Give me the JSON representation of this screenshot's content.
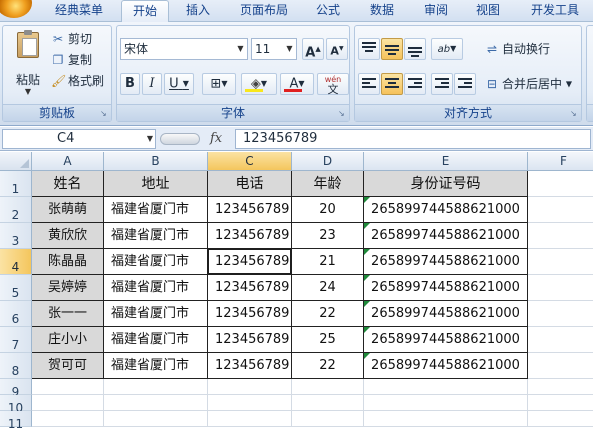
{
  "ribbon_tabs": [
    {
      "label": "经典菜单",
      "active": false
    },
    {
      "label": "开始",
      "active": true
    },
    {
      "label": "插入",
      "active": false
    },
    {
      "label": "页面布局",
      "active": false
    },
    {
      "label": "公式",
      "active": false
    },
    {
      "label": "数据",
      "active": false
    },
    {
      "label": "审阅",
      "active": false
    },
    {
      "label": "视图",
      "active": false
    },
    {
      "label": "开发工具",
      "active": false
    }
  ],
  "clipboard": {
    "paste_label": "粘贴",
    "cut_label": "剪切",
    "copy_label": "复制",
    "format_painter_label": "格式刷",
    "group_label": "剪贴板"
  },
  "font": {
    "font_name": "宋体",
    "font_size": "11",
    "grow_label": "A",
    "shrink_label": "A",
    "bold_label": "B",
    "italic_label": "I",
    "underline_label": "U",
    "font_color_label": "A",
    "phonetic_label": "wén",
    "phonetic_char": "文",
    "group_label": "字体"
  },
  "alignment": {
    "wrap_text_label": "自动换行",
    "merge_center_label": "合并后居中",
    "group_label": "对齐方式",
    "orientation_label": "ab"
  },
  "formula_bar": {
    "name_box": "C4",
    "fx_label": "fx",
    "content": "123456789"
  },
  "colors": {
    "header_fill": "#d9d9d9",
    "selected_header": "#f4c65d",
    "ribbon_text": "#15428b",
    "error_triangle": "#1f8a3a"
  },
  "sheet": {
    "columns": [
      "A",
      "B",
      "C",
      "D",
      "E",
      "F"
    ],
    "row_numbers": [
      "1",
      "2",
      "3",
      "4",
      "5",
      "6",
      "7",
      "8",
      "9",
      "10",
      "11"
    ],
    "header_row": [
      "姓名",
      "地址",
      "电话",
      "年龄",
      "身份证号码"
    ],
    "rows": [
      [
        "张萌萌",
        "福建省厦门市",
        "123456789",
        "20",
        "265899744588621000"
      ],
      [
        "黄欣欣",
        "福建省厦门市",
        "123456789",
        "23",
        "265899744588621000"
      ],
      [
        "陈晶晶",
        "福建省厦门市",
        "123456789",
        "21",
        "265899744588621000"
      ],
      [
        "吴婷婷",
        "福建省厦门市",
        "123456789",
        "24",
        "265899744588621000"
      ],
      [
        "张一一",
        "福建省厦门市",
        "123456789",
        "22",
        "265899744588621000"
      ],
      [
        "庄小小",
        "福建省厦门市",
        "123456789",
        "25",
        "265899744588621000"
      ],
      [
        "贺可可",
        "福建省厦门市",
        "123456789",
        "22",
        "265899744588621000"
      ]
    ],
    "selected_cell": "C4"
  }
}
